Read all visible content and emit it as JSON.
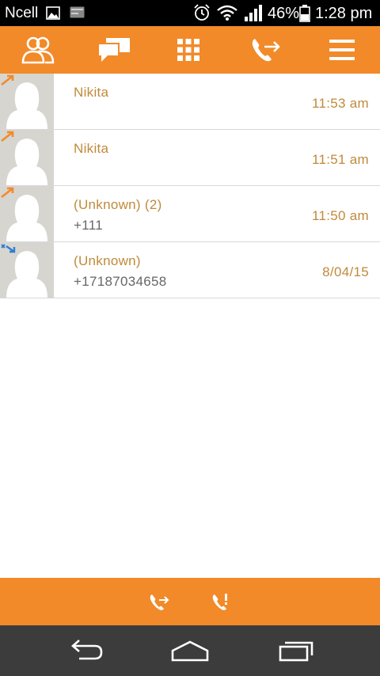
{
  "status_bar": {
    "carrier": "Ncell",
    "battery_percent": "46%",
    "time": "1:28 pm"
  },
  "top_tabs": [
    {
      "icon": "contacts-icon"
    },
    {
      "icon": "messages-icon"
    },
    {
      "icon": "dialpad-icon"
    },
    {
      "icon": "call-log-icon",
      "active": true
    },
    {
      "icon": "menu-icon"
    }
  ],
  "calls": [
    {
      "name": "Nikita",
      "number": "",
      "time": "11:53 am",
      "type": "outgoing"
    },
    {
      "name": "Nikita",
      "number": "",
      "time": "11:51 am",
      "type": "outgoing"
    },
    {
      "name": "(Unknown) (2)",
      "number": "+111",
      "time": "11:50 am",
      "type": "outgoing"
    },
    {
      "name": "(Unknown)",
      "number": "+17187034658",
      "time": "8/04/15",
      "type": "missed"
    }
  ],
  "bottom_actions": [
    {
      "icon": "all-calls-icon"
    },
    {
      "icon": "missed-calls-icon"
    }
  ],
  "colors": {
    "accent": "#f28a29",
    "name_text": "#c08a3b",
    "outgoing_arrow": "#f28a29",
    "missed_arrow": "#2f7fd3",
    "nav_bar": "#3c3c3c"
  }
}
